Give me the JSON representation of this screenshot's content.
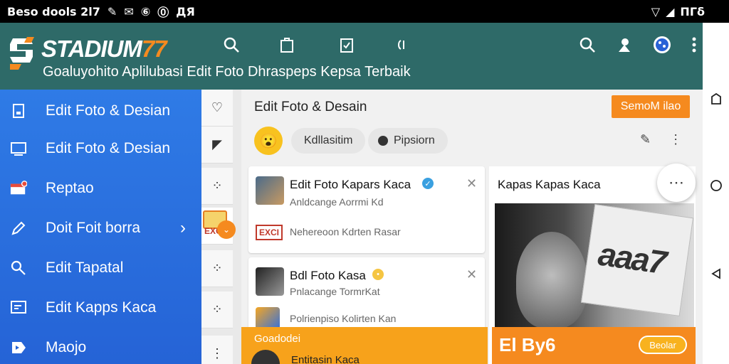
{
  "status_bar": {
    "left_text": "Beso dools 2l7",
    "right_text": "ΠΓδ"
  },
  "header": {
    "brand_part1": "STADIUM",
    "brand_part2": "77",
    "tagline": "Goaluyohito Aplilubasi Edit Foto Dhraspeps Kepsa Terbaik",
    "icons": [
      "search-icon",
      "bag-icon",
      "task-check-icon",
      "info-icon",
      "search-icon",
      "user-icon",
      "globe-icon",
      "more-vert-icon"
    ]
  },
  "sidebar": {
    "items": [
      {
        "label": "Edit Foto & Desian",
        "icon": "tablet-icon"
      },
      {
        "label": "Edit Foto & Desian",
        "icon": "monitor-icon"
      },
      {
        "label": "Reptao",
        "icon": "mail-icon"
      },
      {
        "label": "Doit Foit borra",
        "icon": "edit-icon"
      },
      {
        "label": "Edit Tapatal",
        "icon": "search-icon"
      },
      {
        "label": "Edit Kapps Kaca",
        "icon": "chat-icon"
      },
      {
        "label": "Maojo",
        "icon": "flag-icon"
      }
    ]
  },
  "narrow": {
    "badge_text": "EXCI"
  },
  "main": {
    "title": "Edit Foto & Desain",
    "promo_button": "SemoM ilao",
    "chip1": "Kdllasitim",
    "chip2": "Pipsiorn"
  },
  "cards": [
    {
      "title": "Edit Foto Kapars Kaca",
      "sub": "Anldcange Aorrmi Kd",
      "extra": "Nehereoon Kdrten Rasar"
    },
    {
      "title": "Bdl Foto Kasa",
      "sub": "Pnlacange TormrKat",
      "extra": "Polrienpiso Kolirten Kan"
    }
  ],
  "right_card": {
    "title": "Kapas Kapas Kaca",
    "paper_text": "aaa7"
  },
  "bottom": {
    "orange_label": "Goadodei",
    "orange_sub": "Entitasin Kaca",
    "banner_text": "El By6",
    "banner_button": "Beolar"
  }
}
